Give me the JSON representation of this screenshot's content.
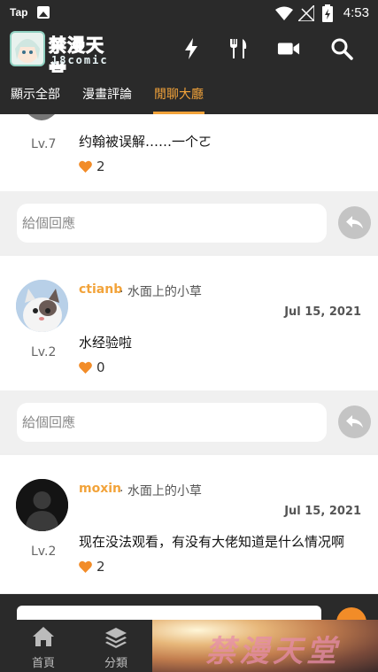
{
  "status_bar": {
    "app_label": "Tap",
    "time": "4:53"
  },
  "app_bar": {
    "logo_title": "禁漫天堂",
    "logo_subtitle": "18comic"
  },
  "tabs": [
    {
      "label": "顯示全部",
      "active": false
    },
    {
      "label": "漫畫評論",
      "active": false
    },
    {
      "label": "閒聊大廳",
      "active": true
    }
  ],
  "comments": [
    {
      "level": "Lv.7",
      "message": "约翰被误解……一个ㄛ",
      "likes": "2",
      "reply_placeholder": "給個回應"
    },
    {
      "username": "ctianb",
      "title": "· 水面上的小草",
      "date": "Jul 15, 2021",
      "level": "Lv.2",
      "message": "水经验啦",
      "likes": "0",
      "reply_placeholder": "給個回應"
    },
    {
      "username": "moxin",
      "title": "· 水面上的小草",
      "date": "Jul 15, 2021",
      "level": "Lv.2",
      "message": "现在没法观看，有没有大佬知道是什么情况啊",
      "likes": "2"
    }
  ],
  "bottom_nav": [
    {
      "label": "首頁"
    },
    {
      "label": "分類"
    }
  ],
  "ad": {
    "text": "禁漫天堂"
  },
  "colors": {
    "accent": "#f2a33a",
    "bar_bg": "#2a2a2a",
    "like_heart": "#f28c28"
  }
}
